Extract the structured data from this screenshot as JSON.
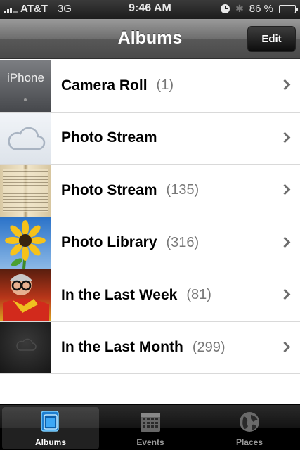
{
  "status_bar": {
    "carrier": "AT&T",
    "network": "3G",
    "time": "9:46 AM",
    "battery": "86 %",
    "battery_level": 0.86,
    "icons": [
      "signal-icon",
      "clock-icon",
      "bluetooth-icon",
      "battery-icon"
    ]
  },
  "nav": {
    "title": "Albums",
    "edit_label": "Edit"
  },
  "albums": [
    {
      "name": "Camera Roll",
      "count": "(1)",
      "thumb_label": "iPhone"
    },
    {
      "name": "Photo Stream",
      "count": ""
    },
    {
      "name": "Photo Stream",
      "count": "(135)"
    },
    {
      "name": "Photo Library",
      "count": "(316)"
    },
    {
      "name": "In the Last Week",
      "count": "(81)"
    },
    {
      "name": "In the Last Month",
      "count": "(299)"
    }
  ],
  "tabs": [
    {
      "label": "Albums",
      "icon": "albums-icon",
      "active": true
    },
    {
      "label": "Events",
      "icon": "calendar-icon",
      "active": false
    },
    {
      "label": "Places",
      "icon": "globe-icon",
      "active": false
    }
  ],
  "colors": {
    "accent": "#3ea8f5",
    "chevron": "#6d6d6d",
    "count_text": "#777777"
  }
}
